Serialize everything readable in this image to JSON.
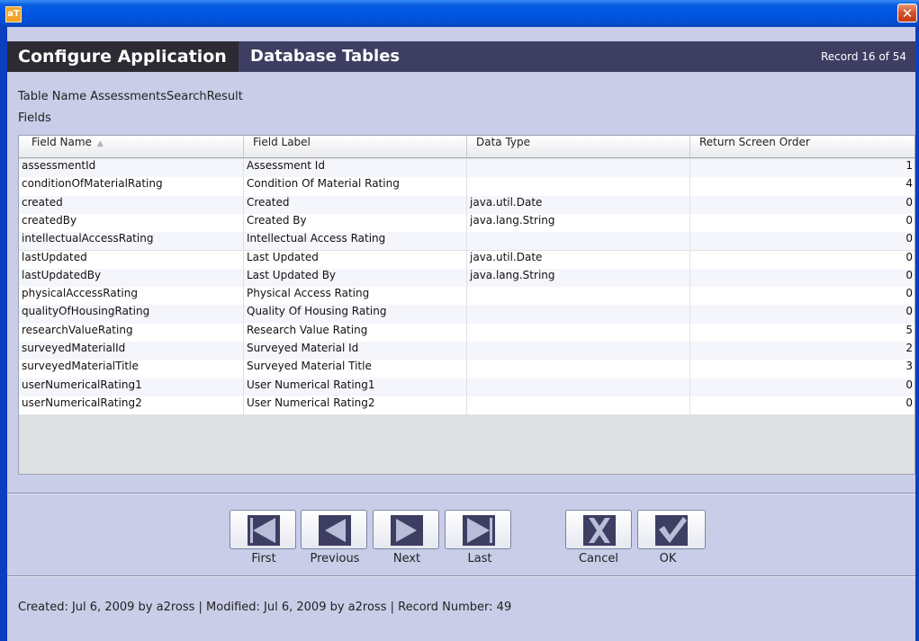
{
  "window": {
    "icon_text": "aT",
    "close_symbol": "✕"
  },
  "header": {
    "app_title": "Configure Application",
    "section_title": "Database Tables",
    "record_counter": "Record 16 of 54"
  },
  "form": {
    "table_name_label": "Table Name AssessmentsSearchResult",
    "fields_label": "Fields"
  },
  "grid": {
    "columns": [
      "Field Name",
      "Field Label",
      "Data Type",
      "Return Screen Order"
    ],
    "sorted_column": "Field Name",
    "rows": [
      {
        "field_name": "assessmentId",
        "field_label": "Assessment Id",
        "data_type": "",
        "order": "1"
      },
      {
        "field_name": "conditionOfMaterialRating",
        "field_label": "Condition Of Material Rating",
        "data_type": "",
        "order": "4"
      },
      {
        "field_name": "created",
        "field_label": "Created",
        "data_type": "java.util.Date",
        "order": "0"
      },
      {
        "field_name": "createdBy",
        "field_label": "Created By",
        "data_type": "java.lang.String",
        "order": "0"
      },
      {
        "field_name": "intellectualAccessRating",
        "field_label": "Intellectual Access Rating",
        "data_type": "",
        "order": "0"
      },
      {
        "field_name": "lastUpdated",
        "field_label": "Last Updated",
        "data_type": "java.util.Date",
        "order": "0"
      },
      {
        "field_name": "lastUpdatedBy",
        "field_label": "Last Updated By",
        "data_type": "java.lang.String",
        "order": "0"
      },
      {
        "field_name": "physicalAccessRating",
        "field_label": "Physical Access Rating",
        "data_type": "",
        "order": "0"
      },
      {
        "field_name": "qualityOfHousingRating",
        "field_label": "Quality Of Housing Rating",
        "data_type": "",
        "order": "0"
      },
      {
        "field_name": "researchValueRating",
        "field_label": "Research Value Rating",
        "data_type": "",
        "order": "5"
      },
      {
        "field_name": "surveyedMaterialId",
        "field_label": "Surveyed Material Id",
        "data_type": "",
        "order": "2"
      },
      {
        "field_name": "surveyedMaterialTitle",
        "field_label": "Surveyed Material Title",
        "data_type": "",
        "order": "3"
      },
      {
        "field_name": "userNumericalRating1",
        "field_label": "User Numerical Rating1",
        "data_type": "",
        "order": "0"
      },
      {
        "field_name": "userNumericalRating2",
        "field_label": "User Numerical Rating2",
        "data_type": "",
        "order": "0"
      }
    ]
  },
  "buttons": {
    "first": "First",
    "previous": "Previous",
    "next": "Next",
    "last": "Last",
    "cancel": "Cancel",
    "ok": "OK"
  },
  "status": "Created: Jul 6, 2009 by a2ross | Modified: Jul 6, 2009 by a2ross | Record Number: 49",
  "colors": {
    "title_bar": "#0054e3",
    "header_band": "#3e3d62",
    "header_app": "#2d2a33",
    "client_bg": "#c9cde8",
    "nav_icon": "#3e3d62"
  },
  "icons": {
    "first": "first-record-icon",
    "previous": "previous-record-icon",
    "next": "next-record-icon",
    "last": "last-record-icon",
    "cancel": "cancel-x-icon",
    "ok": "ok-check-icon"
  }
}
